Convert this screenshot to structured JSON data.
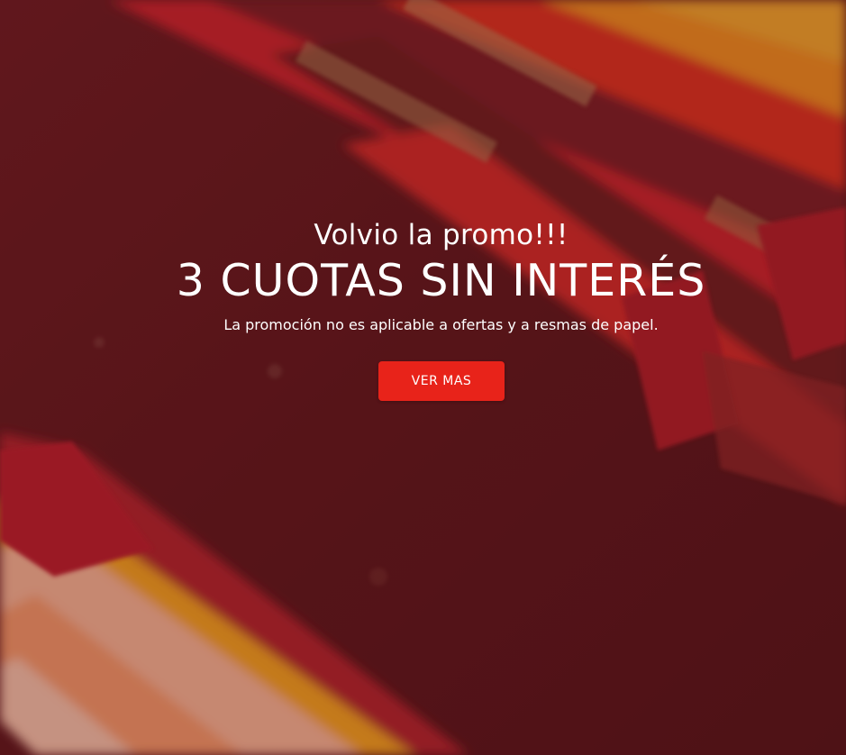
{
  "hero": {
    "pre_title": "Volvio la promo!!!",
    "title": "3 CUOTAS SIN INTERÉS",
    "subtitle": "La promoción no es aplicable a ofertas y a resmas de papel.",
    "cta_label": "VER MAS",
    "background_image": "blurred-colored-pencils-in-red-case",
    "overlay_color": "#6e1419",
    "cta_color": "#e8231a",
    "text_color": "#ffffff"
  }
}
